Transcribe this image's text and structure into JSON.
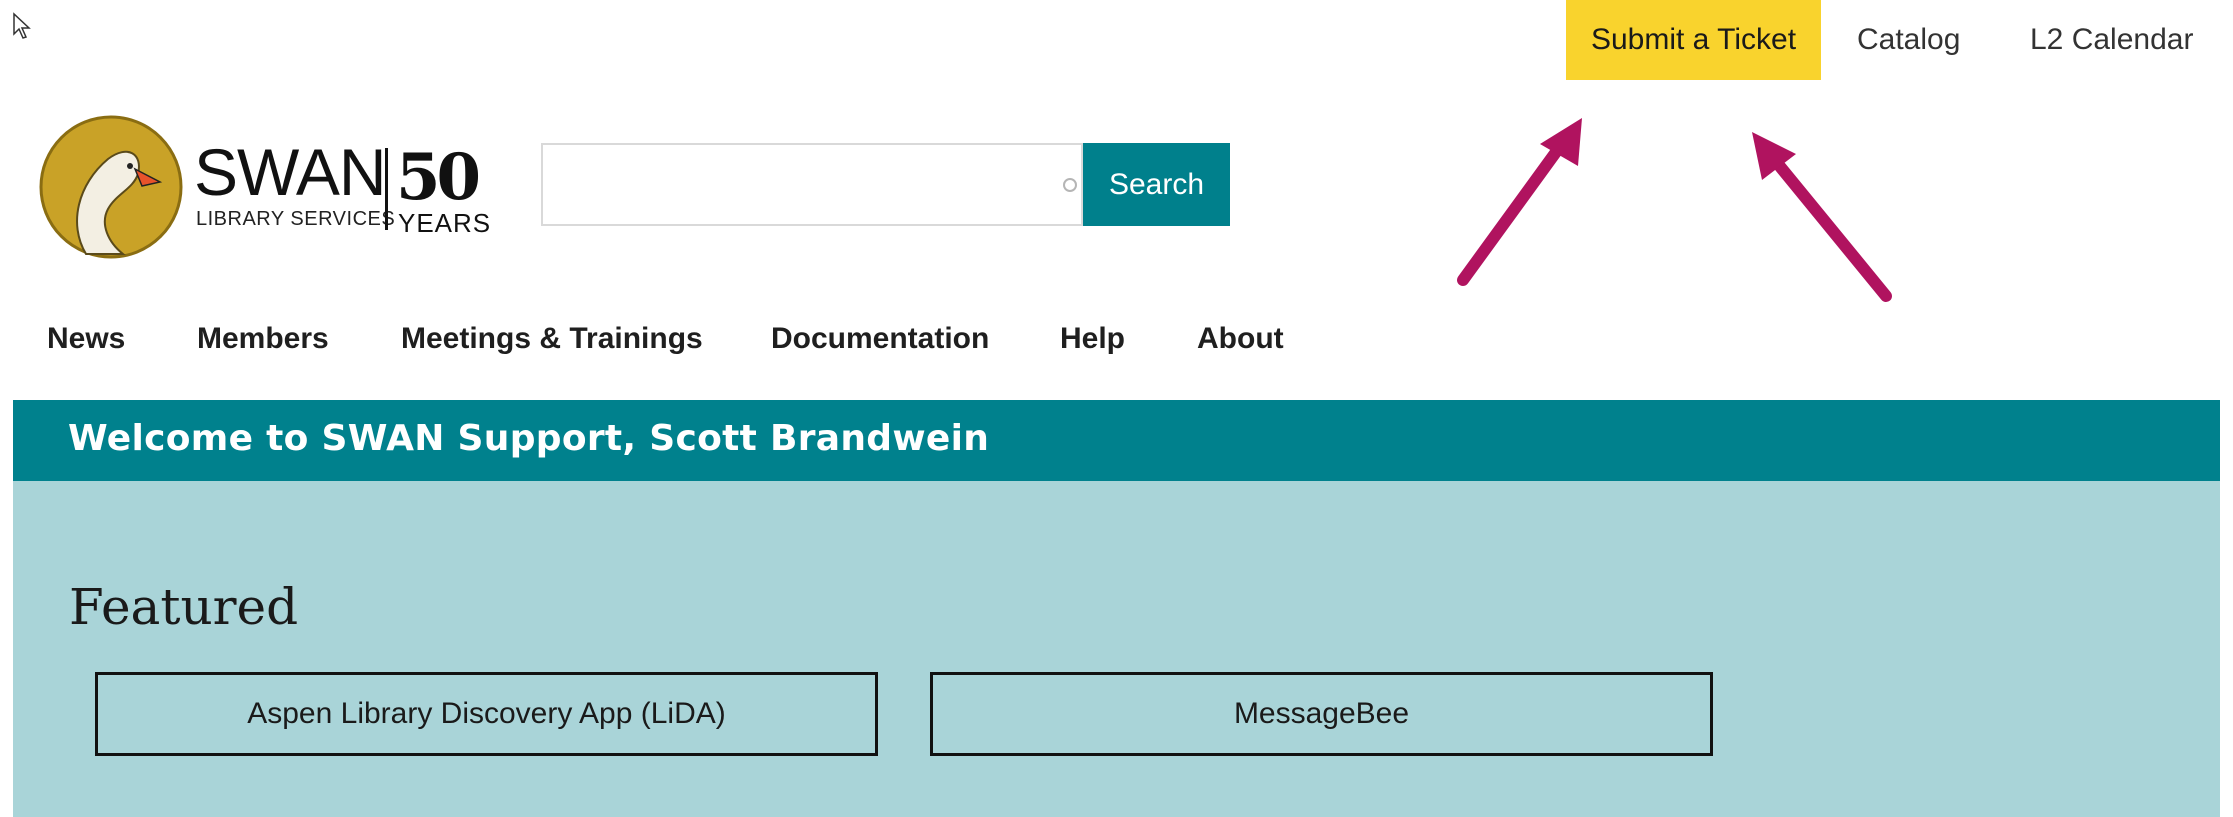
{
  "utility_nav": {
    "submit_ticket": "Submit a Ticket",
    "catalog": "Catalog",
    "l2_calendar": "L2 Calendar"
  },
  "logo": {
    "name": "SWAN",
    "subtitle": "LIBRARY SERVICES",
    "anniversary_number": "50",
    "anniversary_label": "YEARS"
  },
  "search": {
    "value": "",
    "button_label": "Search"
  },
  "main_nav": [
    "News",
    "Members",
    "Meetings & Trainings",
    "Documentation",
    "Help",
    "About"
  ],
  "welcome": {
    "text": "Welcome to SWAN Support, Scott Brandwein"
  },
  "featured": {
    "title": "Featured",
    "items": [
      "Aspen Library Discovery App (LiDA)",
      "MessageBee"
    ]
  },
  "colors": {
    "ticket_yellow": "#f9d32d",
    "teal": "#00818d",
    "light_teal": "#a9d4d8",
    "arrow_magenta": "#b0135f",
    "logo_gold": "#c9a227"
  }
}
